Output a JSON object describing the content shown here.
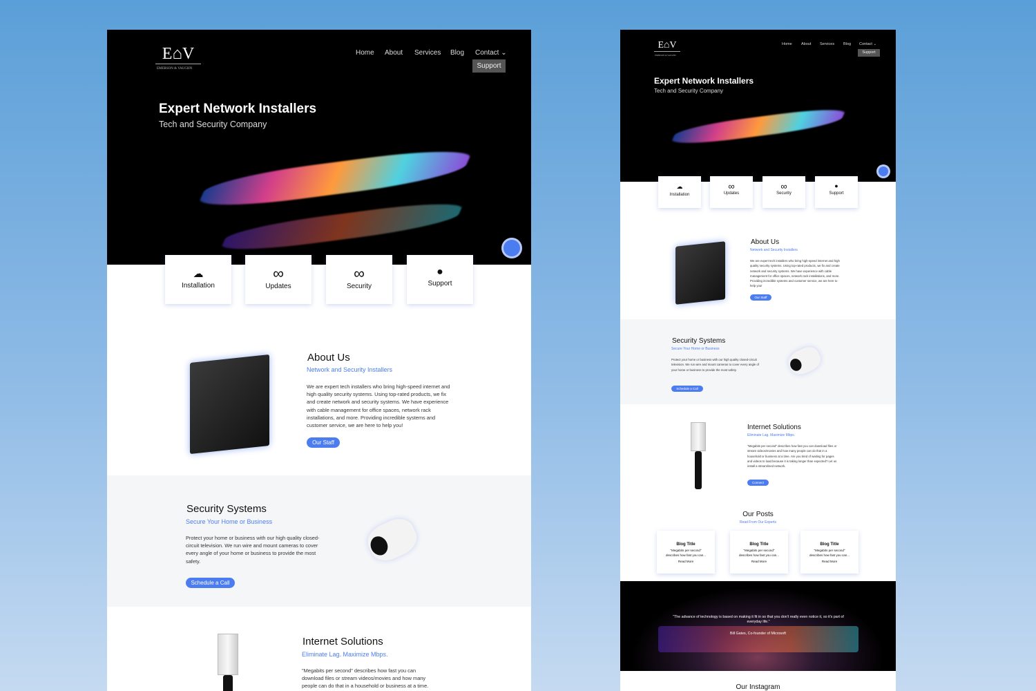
{
  "site": {
    "logo_mark": "E⌂V",
    "logo_sub": "EMERSON & VAUGHN",
    "nav": [
      "Home",
      "About",
      "Services",
      "Blog",
      "Contact ⌄"
    ],
    "support_btn": "Support",
    "hero_title": "Expert Network Installers",
    "hero_sub": "Tech and Security Company",
    "services": [
      {
        "label": "Installation",
        "icon": "cloud-check-icon"
      },
      {
        "label": "Updates",
        "icon": "infinity-icon"
      },
      {
        "label": "Security",
        "icon": "infinity-icon"
      },
      {
        "label": "Support",
        "icon": "chat-bubble-icon"
      }
    ],
    "about": {
      "title": "About Us",
      "subtitle": "Network and Security Installers",
      "body": "We are expert tech installers who bring high-speed internet and high quality security systems. Using top-rated products, we fix and create network and security systems. We have experience with cable management for office spaces, network rack installations, and more. Providing incredible systems and customer service, we are here to help you!",
      "button": "Our Staff"
    },
    "security": {
      "title": "Security Systems",
      "subtitle": "Secure Your Home or Business",
      "body": "Protect your home or business with our high quality closed-circuit television. We run wire and mount cameras to cover every angle of your home or business to provide the most safety.",
      "button": "Schedule a Call"
    },
    "internet": {
      "title": "Internet Solutions",
      "subtitle": "Eliminate Lag. Maximize Mbps.",
      "body": "\"Megabits per second\" describes how fast you can download files or stream videos/movies and how many people can do that in a household or business at a time. Are you tired of waiting for pages and videos to load because it is taking longer than expected? Let us install a streamlined network.",
      "button": "Connect"
    },
    "posts": {
      "title": "Our Posts",
      "subtitle": "Read From Our Experts",
      "items": [
        {
          "title": "Blog Title",
          "excerpt": "\"Megabits per second\" describes how fast you can...",
          "link": "Read More"
        },
        {
          "title": "Blog Title",
          "excerpt": "\"Megabits per second\" describes how fast you can...",
          "link": "Read More"
        },
        {
          "title": "Blog Title",
          "excerpt": "\"Megabits per second\" describes how fast you can...",
          "link": "Read More"
        }
      ]
    },
    "quote": {
      "text": "\"The advance of technology is based on making it fit in so that you don't really even notice it, so it's part of everyday life.\"",
      "author": "Bill Gates, Co-founder of Microsoft"
    },
    "instagram": {
      "title": "Our Instagram"
    }
  },
  "colors": {
    "accent": "#4c7df0",
    "hero_bg": "#000000",
    "section_gray": "#f5f6f8"
  }
}
